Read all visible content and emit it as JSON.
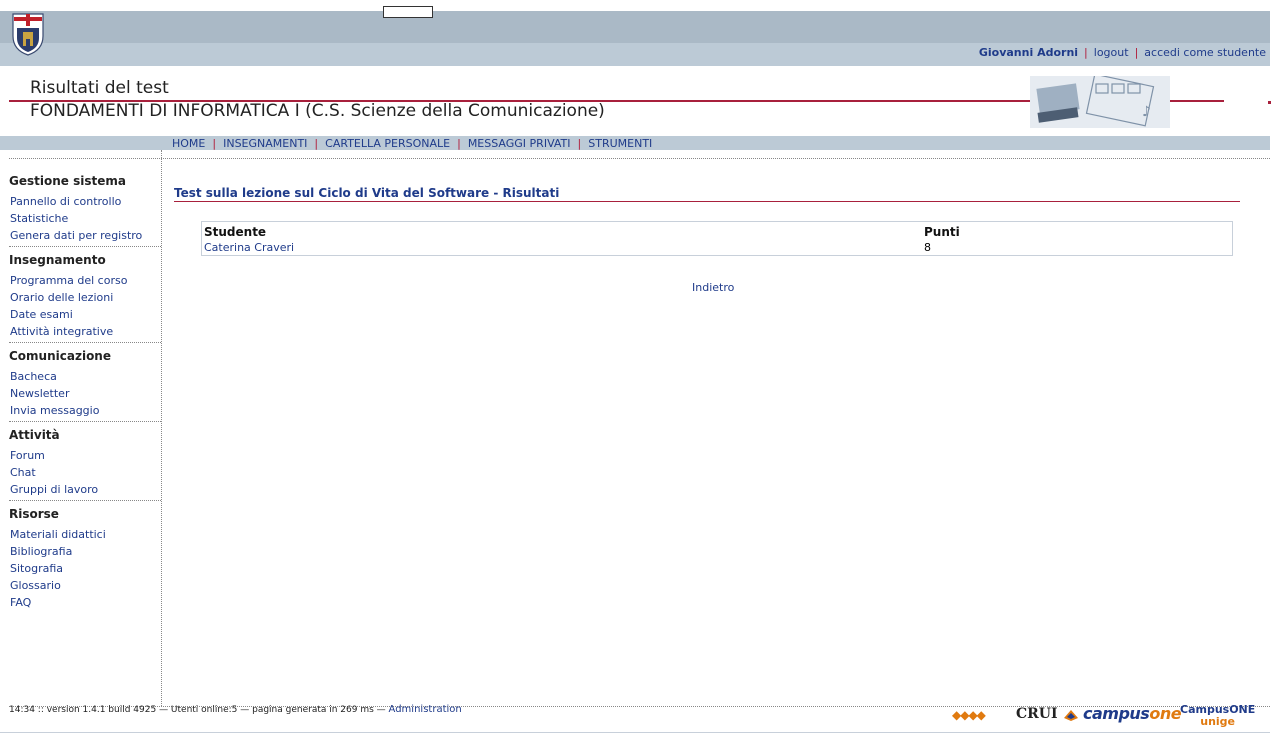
{
  "header": {
    "user_name": "Giovanni Adorni",
    "logout_label": "logout",
    "student_view_label": "accedi come studente"
  },
  "page": {
    "title": "Risultati del test",
    "course": "FONDAMENTI DI INFORMATICA I (C.S. Scienze della Comunicazione)"
  },
  "navbar": {
    "items": [
      "HOME",
      "INSEGNAMENTI",
      "CARTELLA PERSONALE",
      "MESSAGGI PRIVATI",
      "STRUMENTI"
    ]
  },
  "sidebar": {
    "sections": [
      {
        "heading": "Gestione sistema",
        "items": [
          "Pannello di controllo",
          "Statistiche",
          "Genera dati per registro"
        ]
      },
      {
        "heading": "Insegnamento",
        "items": [
          "Programma del corso",
          "Orario delle lezioni",
          "Date esami",
          "Attività integrative"
        ]
      },
      {
        "heading": "Comunicazione",
        "items": [
          "Bacheca",
          "Newsletter",
          "Invia messaggio"
        ]
      },
      {
        "heading": "Attività",
        "items": [
          "Forum",
          "Chat",
          "Gruppi di lavoro"
        ]
      },
      {
        "heading": "Risorse",
        "items": [
          "Materiali didattici",
          "Bibliografia",
          "Sitografia",
          "Glossario",
          "FAQ"
        ]
      }
    ]
  },
  "results": {
    "heading": "Test sulla lezione sul Ciclo di Vita del Software - Risultati",
    "columns": [
      "Studente",
      "Punti"
    ],
    "rows": [
      [
        "Caterina Craveri",
        "8"
      ]
    ],
    "back_label": "Indietro"
  },
  "footer": {
    "status": "14:34 :: version 1.4.1 build 4925 — Utenti online:5 — pagina generata in 269 ms —",
    "admin_link": "Administration",
    "logos": {
      "diamonds": "◆◆◆◆",
      "crui": "CRUI",
      "campus": "campus",
      "campus_one": "one",
      "campusone": "CampusONE",
      "unige": "unige"
    }
  },
  "colors": {
    "accent_red": "#a8203c",
    "link_blue": "#1f3b8a",
    "bar_grey": "#bccad6",
    "logo_orange": "#e07a10"
  },
  "icons": [
    "university-crest-icon",
    "film-banner-image",
    "campus-logo-icon"
  ]
}
